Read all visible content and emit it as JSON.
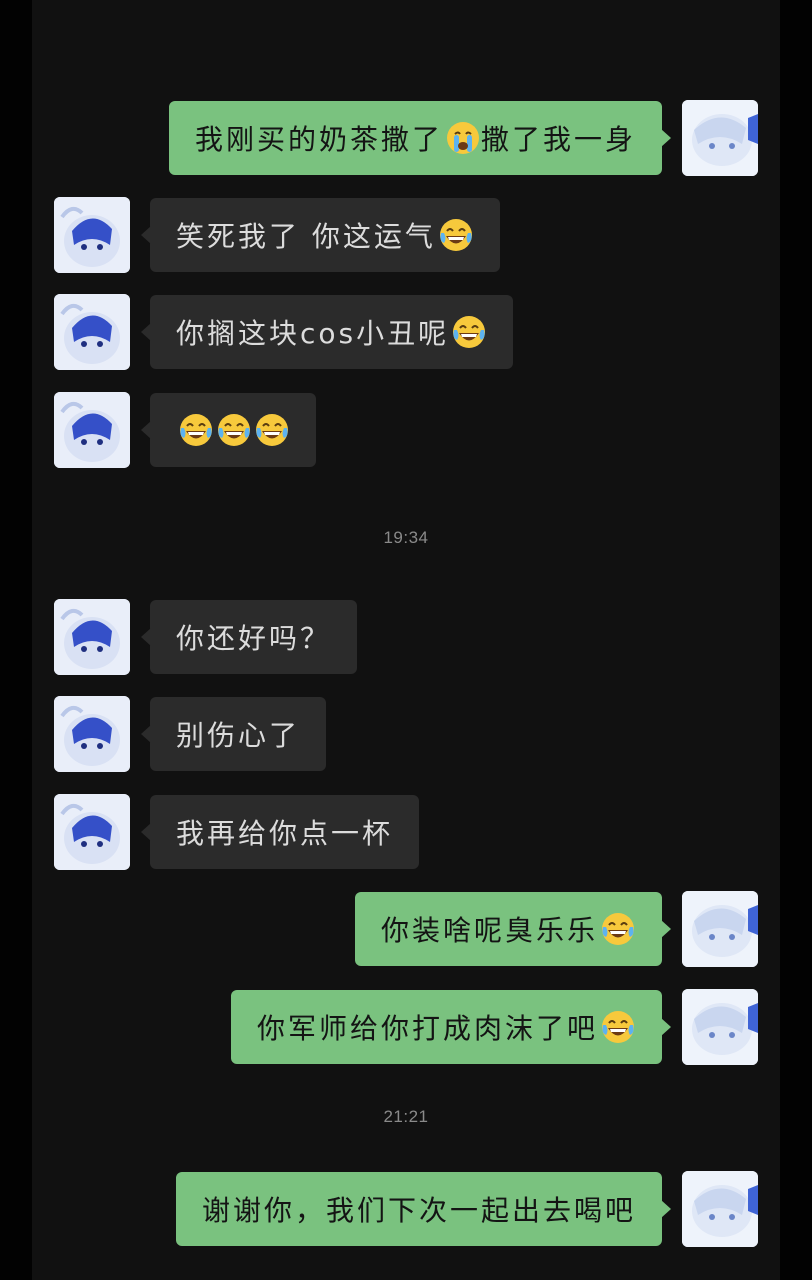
{
  "faded_header": "",
  "messages": [
    {
      "side": "out",
      "text": "我刚买的奶茶撒了",
      "emoji": "crying-face",
      "text2": "撒了我一身"
    },
    {
      "side": "in",
      "text": "笑死我了 你这运气",
      "emoji": "tears-of-joy"
    },
    {
      "side": "in",
      "text": "你搁这块cos小丑呢",
      "emoji": "tears-of-joy"
    },
    {
      "side": "in",
      "text": "",
      "emojis": [
        "tears-of-joy",
        "tears-of-joy",
        "tears-of-joy"
      ]
    },
    {
      "type": "time",
      "text": "19:34"
    },
    {
      "side": "in",
      "text": "你还好吗？"
    },
    {
      "side": "in",
      "text": "别伤心了"
    },
    {
      "side": "in",
      "text": "我再给你点一杯"
    },
    {
      "side": "out",
      "text": "你装啥呢臭乐乐",
      "emoji": "tears-of-joy"
    },
    {
      "side": "out",
      "text": "你军师给你打成肉沫了吧",
      "emoji": "tears-of-joy"
    },
    {
      "type": "time",
      "text": "21:21"
    },
    {
      "side": "out",
      "text": "谢谢你，我们下次一起出去喝吧"
    }
  ],
  "colors": {
    "background": "#111111",
    "incoming_bubble": "#2b2b2b",
    "outgoing_bubble": "#7ac27f",
    "timestamp": "#8a8a8a"
  }
}
